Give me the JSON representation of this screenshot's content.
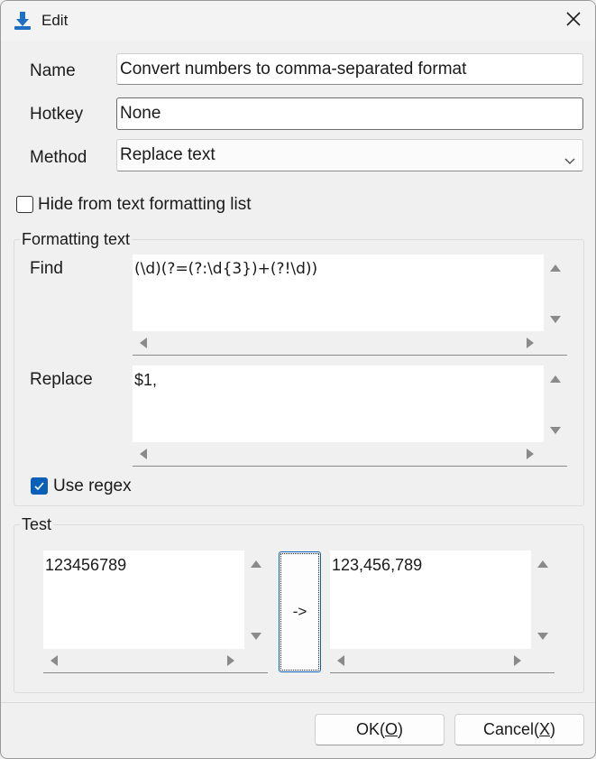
{
  "window": {
    "title": "Edit"
  },
  "form": {
    "name_label": "Name",
    "name_value": "Convert numbers to comma-separated format",
    "hotkey_label": "Hotkey",
    "hotkey_value": "None",
    "method_label": "Method",
    "method_value": "Replace text",
    "hide_label": "Hide from text formatting list",
    "hide_checked": false
  },
  "formatting": {
    "title": "Formatting text",
    "find_label": "Find",
    "find_value": "(\\d)(?=(?:\\d{3})+(?!\\d))",
    "replace_label": "Replace",
    "replace_value": "$1,",
    "regex_label": "Use regex",
    "regex_checked": true
  },
  "test": {
    "title": "Test",
    "input_value": "123456789",
    "convert_label": "->",
    "output_value": "123,456,789"
  },
  "footer": {
    "ok_text": "OK(",
    "ok_key": "O",
    "ok_end": ")",
    "cancel_text": "Cancel(",
    "cancel_key": "X",
    "cancel_end": ")"
  },
  "colors": {
    "accent": "#0a5fb8",
    "background": "#f0f0f0",
    "icon_blue": "#1f6fc5"
  }
}
